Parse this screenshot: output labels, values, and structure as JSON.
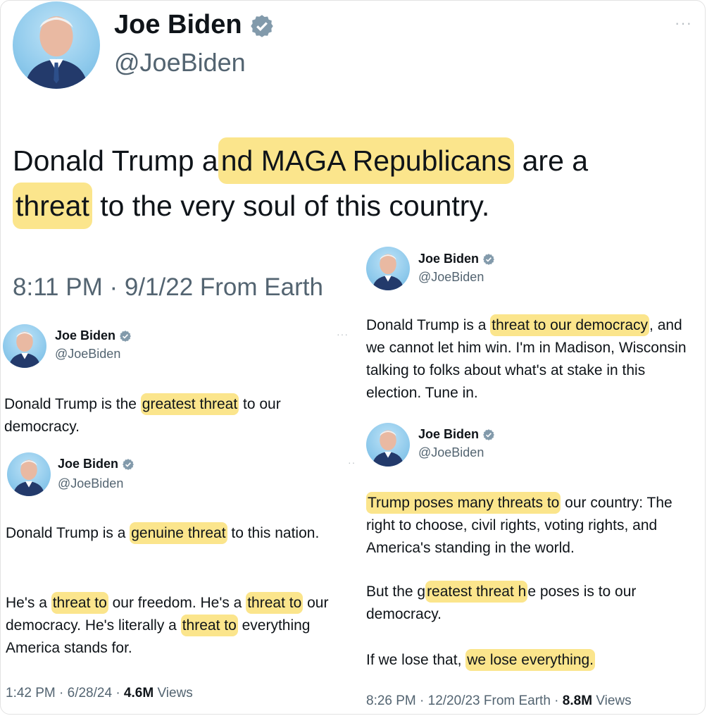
{
  "main": {
    "name": "Joe Biden",
    "handle": "@JoeBiden",
    "menu": "···",
    "text": {
      "p1": "Donald Trump a",
      "hl1": "nd MAGA Republicans",
      "p2": " are a ",
      "hl2": "threat",
      "p3": " to the very soul of this country."
    },
    "time": "8:11 PM · 9/1/22 From Earth"
  },
  "tweet_a": {
    "name": "Joe Biden",
    "handle": "@JoeBiden",
    "menu": "···",
    "p1": "Donald Trump is the ",
    "hl1": "greatest threat",
    "p2": " to our democracy."
  },
  "tweet_b": {
    "name": "Joe Biden",
    "handle": "@JoeBiden",
    "menu": "··",
    "para1": {
      "p1": "Donald Trump is a ",
      "hl1": "genuine threat",
      "p2": " to this nation."
    },
    "para2": {
      "p1": "He's a ",
      "hl1": "threat to",
      "p2": " our freedom. He's a ",
      "hl2": "threat to",
      "p3": " our democracy. He's literally a ",
      "hl3": "threat to",
      "p4": " everything America stands for."
    },
    "time": "1:42 PM · 6/28/24 · ",
    "views_count": "4.6M",
    "views_label": " Views"
  },
  "tweet_c": {
    "name": "Joe Biden",
    "handle": "@JoeBiden",
    "p1": "Donald Trump is a ",
    "hl1": "threat to our democracy",
    "p2": ", and we cannot let him win. I'm in Madison, Wisconsin talking to folks about what's at stake in this election. Tune in."
  },
  "tweet_d": {
    "name": "Joe Biden",
    "handle": "@JoeBiden",
    "para1": {
      "hl1": "Trump poses many threats to",
      "p1": " our country: The right to choose, civil rights, voting rights, and America's standing in the world."
    },
    "para2": {
      "p1": "But the g",
      "hl1": "reatest threat h",
      "p2": "e poses is to our democracy."
    },
    "para3": {
      "p1": "If we lose that, ",
      "hl1": "we lose everything."
    },
    "time": "8:26 PM · 12/20/23 From Earth · ",
    "views_count": "8.8M",
    "views_label": " Views"
  },
  "colors": {
    "highlight": "#fbe58c",
    "verified": "#829aab",
    "text": "#0f1419",
    "muted": "#536471"
  }
}
